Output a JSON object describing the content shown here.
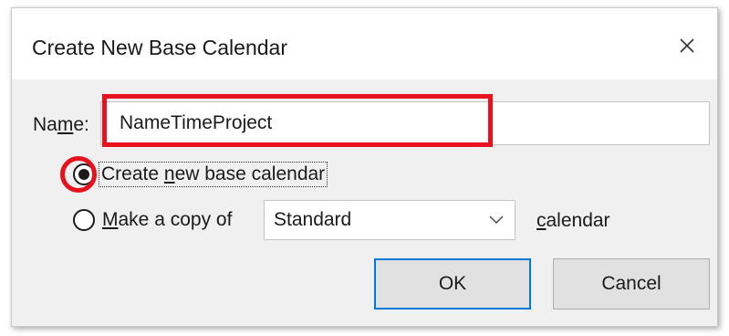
{
  "dialog": {
    "title": "Create New Base Calendar",
    "close_glyph": "×"
  },
  "name_field": {
    "label_pre": "Na",
    "label_access": "m",
    "label_post": "e:",
    "value": "NameTimeProject"
  },
  "options": {
    "create_new": {
      "pre": "Create ",
      "access": "n",
      "post": "ew base calendar",
      "selected": true
    },
    "make_copy": {
      "access": "M",
      "post": "ake a copy of",
      "selected": false
    }
  },
  "copy_source": {
    "selected": "Standard"
  },
  "calendar_suffix": {
    "access": "c",
    "post": "alendar"
  },
  "buttons": {
    "ok": "OK",
    "cancel": "Cancel"
  },
  "colors": {
    "highlight": "#e8121e",
    "default_button_border": "#0078d7",
    "body_background": "#f0f0f0"
  },
  "icons": {
    "close": "close-icon",
    "dropdown": "chevron-down-icon"
  }
}
